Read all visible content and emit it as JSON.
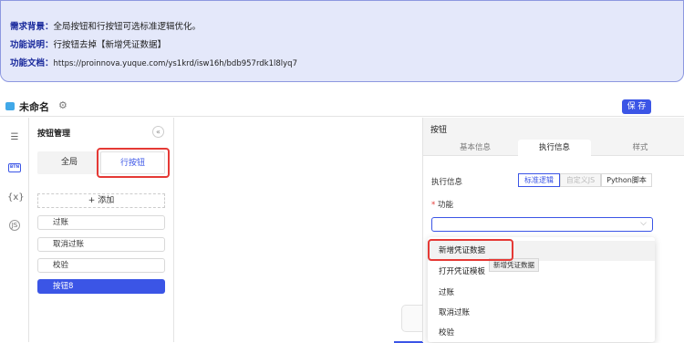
{
  "notice": {
    "background_label": "需求背景",
    "background_text": "全局按钮和行按钮可选标准逻辑优化。",
    "function_label": "功能说明",
    "function_text": "行按钮去掉【新增凭证数据】",
    "doc_label": "功能文档",
    "doc_url": "https://proinnova.yuque.com/ys1krd/isw16h/bdb957rdk1l8lyq7"
  },
  "header": {
    "title": "未命名",
    "save_label": "保 存"
  },
  "rail": {
    "btn_label": "BTN",
    "var_label": "{x}",
    "js_label": "JS"
  },
  "button_panel": {
    "title": "按钮管理",
    "tabs": [
      "全局",
      "行按钮"
    ],
    "add_label": "+ 添加",
    "items": [
      "过账",
      "取消过账",
      "校验",
      "按钮8"
    ]
  },
  "props": {
    "title": "按钮",
    "tabs": [
      "基本信息",
      "执行信息",
      "样式"
    ],
    "exec_label": "执行信息",
    "modes": [
      "标准逻辑",
      "自定义JS",
      "Python脚本"
    ],
    "func_label": "功能",
    "options": [
      "新增凭证数据",
      "打开凭证模板",
      "过账",
      "取消过账",
      "校验"
    ],
    "tooltip": "新增凭证数据"
  },
  "colors": {
    "accent": "#3b55e6",
    "highlight": "#e53935",
    "notice_bg": "#e4e8fa"
  }
}
